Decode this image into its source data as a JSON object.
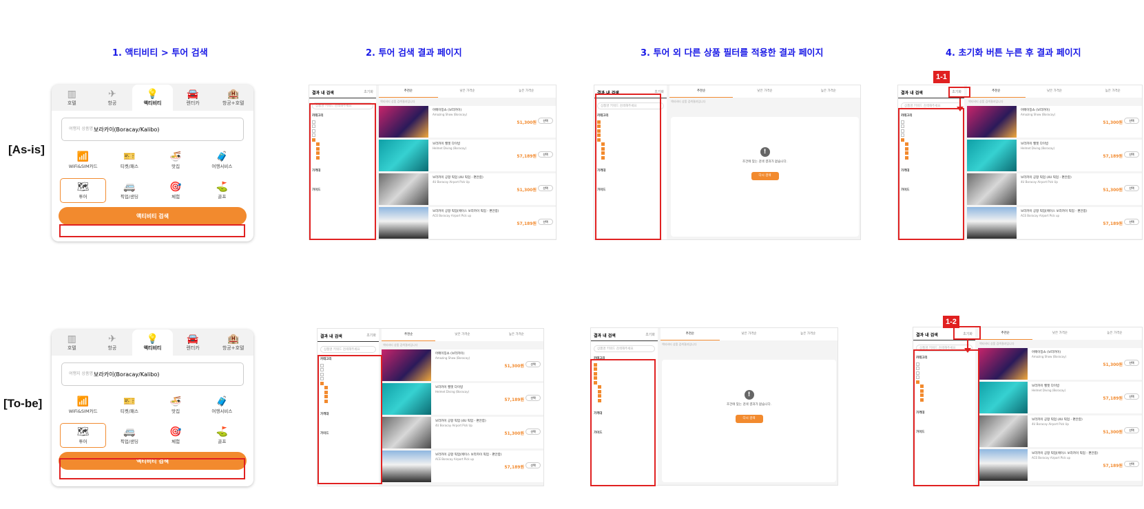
{
  "columns": [
    "1. 액티비티 > 투어 검색",
    "2. 투어 검색 결과 페이지",
    "3. 투어 외 다른 상품 필터를 적용한 결과 페이지",
    "4. 초기화 버튼 누른 후 결과 페이지"
  ],
  "rows": [
    "[As-is]",
    "[To-be]"
  ],
  "tags": [
    "1-1",
    "1-2"
  ],
  "widget": {
    "tabs": [
      "호텔",
      "항공",
      "액티비티",
      "렌터카",
      "항공+호텔"
    ],
    "dest_label": "여행지 상품명",
    "dest_value": "보라카이(Boracay/Kalibo)",
    "grid": [
      "WiFi&SIM카드",
      "티켓/패스",
      "맛집",
      "여행서비스",
      "투어",
      "픽업/샌딩",
      "체험",
      "골프"
    ],
    "cta": "액티비티 검색"
  },
  "results": {
    "side_title": "결과 내 검색",
    "reset": "초기화",
    "search_placeholder": "상품명 키워드 검색해주세요",
    "category": "카테고리",
    "price": "가격대",
    "guide": "가이드",
    "tabs": [
      "추천순",
      "낮은 가격순",
      "높은 가격순"
    ],
    "sub": "액티비티 상품 검색결과입니다",
    "products": [
      {
        "title": "어메이징쇼 (보라카이)",
        "en": "Amazing Show (Boracay)",
        "price": "51,300원"
      },
      {
        "title": "보라카이 헬멧 다이빙",
        "en": "Helmet Diving (Boracay)",
        "price": "57,189원"
      },
      {
        "title": "보라카이 공항 픽업 (4U 픽업 - 편안함)",
        "en": "4U Boracay Airport Pick Up",
        "price": "51,300원"
      },
      {
        "title": "보라카이 공항 픽업(에이스 보라카이 픽업 - 편안함)",
        "en": "ACE Boracay Airport Pick up",
        "price": "57,189원"
      }
    ],
    "select_btn": "선택",
    "empty_msg": "조건에 맞는 검색 결과가 없습니다.",
    "retry": "다시 검색"
  },
  "colors": {
    "accent": "#f28a2e",
    "annotation": "#e02020",
    "title": "#1a1ae6"
  }
}
